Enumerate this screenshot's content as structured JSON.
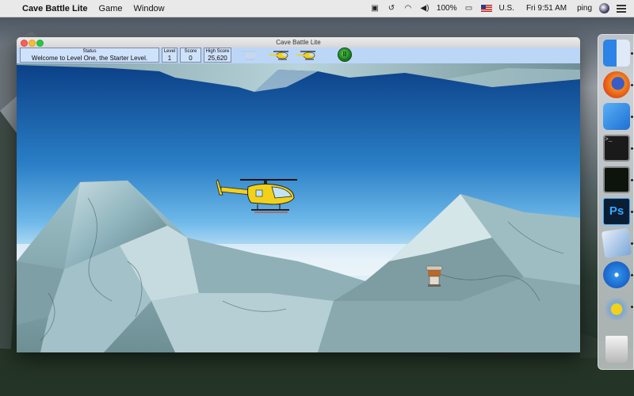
{
  "menubar": {
    "app_name": "Cave Battle Lite",
    "menus": [
      "Game",
      "Window"
    ],
    "battery": "100%",
    "input_source": "U.S.",
    "clock": "Fri 9:51 AM",
    "user": "ping"
  },
  "window": {
    "title": "Cave Battle Lite"
  },
  "hud": {
    "status_label": "Status",
    "status_text": "Welcome to Level One, the Starter Level.",
    "level_label": "Level",
    "level_value": "1",
    "score_label": "Score",
    "score_value": "0",
    "high_score_label": "High Score",
    "high_score_value": "25,620",
    "lives_remaining": 2,
    "lives_total": 3
  },
  "dock": {
    "apps": [
      "finder-icon",
      "firefox-icon",
      "xcode-icon",
      "terminal-icon",
      "activity-monitor-icon",
      "photoshop-icon",
      "preview-icon",
      "safari-icon",
      "cave-battle-icon",
      "trash-icon"
    ]
  },
  "colors": {
    "hud_background": "#bcd6f8",
    "sky_top": "#0b3f86",
    "rock": "#8fb6bf"
  }
}
